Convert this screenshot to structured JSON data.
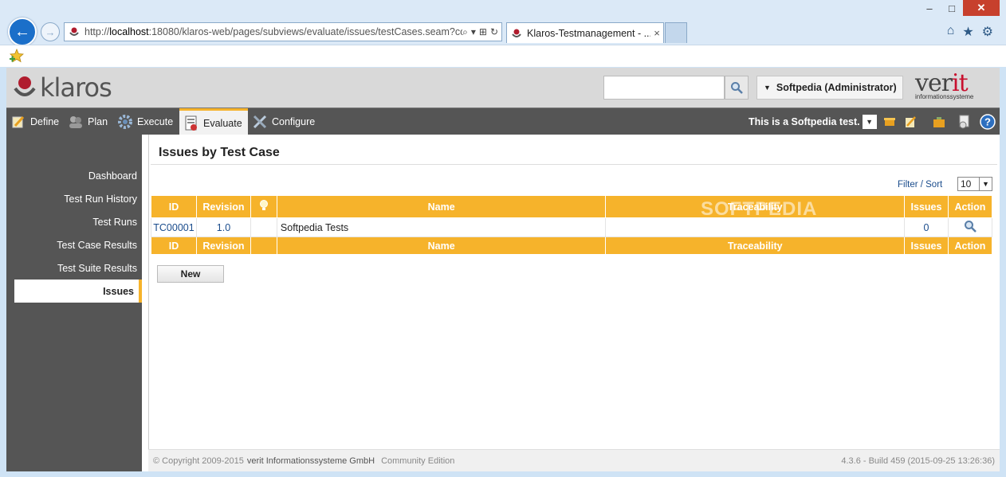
{
  "browser": {
    "url_prefix": "http://",
    "url_host": "localhost",
    "url_rest": ":18080/klaros-web/pages/subviews/evaluate/issues/testCases.seam?co",
    "tab_title": "Klaros-Testmanagement - ...",
    "tab_close": "×",
    "window_controls": [
      "–",
      "□",
      "✕"
    ],
    "back_glyph": "←",
    "fwd_glyph": "→",
    "addr_tools": [
      "⌕",
      "▾",
      "⊞",
      "↻"
    ],
    "right_tools": [
      "⌂",
      "★",
      "⚙"
    ]
  },
  "header": {
    "logo": "klaros",
    "user": "Softpedia (Administrator)",
    "user_caret": "▼",
    "brand_main": "ver",
    "brand_it": "it",
    "brand_sub": "informationssysteme"
  },
  "menu": {
    "items": [
      "Define",
      "Plan",
      "Execute",
      "Evaluate",
      "Configure"
    ],
    "project": "This is a Softpedia test.",
    "dd_glyph": "▼"
  },
  "sidebar": {
    "items": [
      "Dashboard",
      "Test Run History",
      "Test Runs",
      "Test Case Results",
      "Test Suite Results",
      "Issues"
    ]
  },
  "content": {
    "title": "Issues by Test Case",
    "filter_link": "Filter / Sort",
    "page_size": "10",
    "columns": [
      "ID",
      "Revision",
      "",
      "Name",
      "Traceability",
      "Issues",
      "Action"
    ],
    "rows": [
      {
        "id": "TC00001",
        "revision": "1.0",
        "flag": "",
        "name": "Softpedia Tests",
        "traceability": "",
        "issues": "0"
      }
    ],
    "new_button": "New",
    "watermark": "SOFTPEDIA"
  },
  "footer": {
    "copyright": "© Copyright 2009-2015",
    "company": "verit Informationssysteme GmbH",
    "edition": "Community Edition",
    "build": "4.3.6 - Build 459 (2015-09-25 13:26:36)"
  },
  "colors": {
    "accent": "#f6b32b",
    "menubar": "#555555",
    "link": "#1a4c8c",
    "brand_red": "#c8102e"
  }
}
